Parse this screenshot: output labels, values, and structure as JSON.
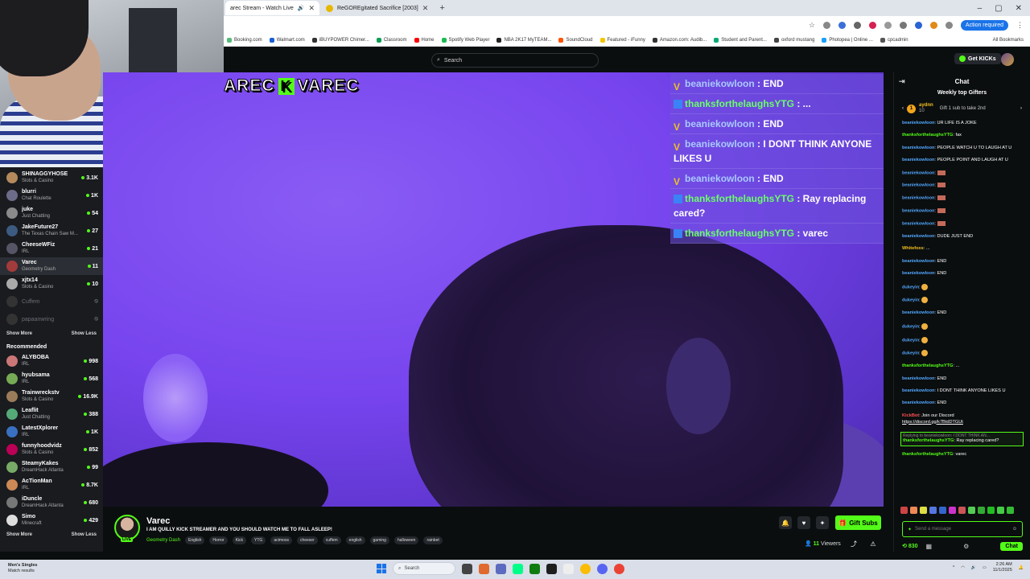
{
  "browser": {
    "tabs": [
      {
        "label": "arec Stream - Watch Live",
        "active": true
      },
      {
        "label": "ReGOREgitated Sacrifice [2003]",
        "active": false
      }
    ],
    "action_required": "Action required",
    "bookmarks": [
      "Booking.com",
      "Walmart.com",
      "iBUYPOWER Chimer...",
      "Classroom",
      "Home",
      "Spotify Web Player",
      "NBA 2K17 MyTEAM...",
      "SoundCloud",
      "Featured - iFunny",
      "Amazon.com: Audib...",
      "Student and Parent...",
      "oxford mustang",
      "Photopea | Online ...",
      "cpcadmin"
    ],
    "all_bookmarks": "All Bookmarks"
  },
  "header": {
    "search_placeholder": "Search",
    "get_kicks": "Get KICKs"
  },
  "sidebar": {
    "following": [
      {
        "name": "SHINAGGYHOSE",
        "category": "Slots & Casino",
        "count": "3.1K",
        "live": true
      },
      {
        "name": "blurri",
        "category": "Chat Roulette",
        "count": "1K",
        "live": true
      },
      {
        "name": "juke",
        "category": "Just Chatting",
        "count": "54",
        "live": true
      },
      {
        "name": "JakeFuture27",
        "category": "The Texas Chain Saw M...",
        "count": "27",
        "live": true
      },
      {
        "name": "CheeseWFiz",
        "category": "IRL",
        "count": "21",
        "live": true
      },
      {
        "name": "Varec",
        "category": "Geometry Dash",
        "count": "11",
        "live": true,
        "selected": true
      },
      {
        "name": "xjtx14",
        "category": "Slots & Casino",
        "count": "10",
        "live": true
      },
      {
        "name": "Cuffem",
        "category": "",
        "count": "",
        "live": false
      },
      {
        "name": "papaanwring",
        "category": "",
        "count": "",
        "live": false
      }
    ],
    "show_more": "Show More",
    "show_less": "Show Less",
    "recommended_title": "Recommended",
    "recommended": [
      {
        "name": "ALYBOBA",
        "category": "IRL",
        "count": "998"
      },
      {
        "name": "hyubsama",
        "category": "IRL",
        "count": "568"
      },
      {
        "name": "Trainwreckstv",
        "category": "Slots & Casino",
        "count": "16.9K"
      },
      {
        "name": "Leaflit",
        "category": "Just Chatting",
        "count": "388"
      },
      {
        "name": "LatestXplorer",
        "category": "IRL",
        "count": "1K"
      },
      {
        "name": "funnyhoodvidz",
        "category": "Slots & Casino",
        "count": "852"
      },
      {
        "name": "SteamyKakes",
        "category": "DreamHack Atlanta",
        "count": "99"
      },
      {
        "name": "AcTionMan",
        "category": "IRL",
        "count": "8.7K"
      },
      {
        "name": "iDuncle",
        "category": "DreamHack Atlanta",
        "count": "680"
      },
      {
        "name": "Simo",
        "category": "Minecraft",
        "count": "429"
      }
    ]
  },
  "overlay": {
    "name_left": "AREC",
    "name_right": "VAREC",
    "chat": [
      {
        "user": "beaniekowloon",
        "text": " : END",
        "style": "u1"
      },
      {
        "user": "thanksforthelaughsYTG",
        "text": " : ...",
        "style": "u2"
      },
      {
        "user": "beaniekowloon",
        "text": " : END",
        "style": "u1"
      },
      {
        "user": "beaniekowloon",
        "text": " : I DONT THINK ANYONE LIKES U",
        "style": "u1"
      },
      {
        "user": "beaniekowloon",
        "text": " : END",
        "style": "u1"
      },
      {
        "user": "thanksforthelaughsYTG",
        "text": " : Ray replacing cared?",
        "style": "u2"
      },
      {
        "user": "thanksforthelaughsYTG",
        "text": " : varec",
        "style": "u2"
      }
    ]
  },
  "stream": {
    "name": "Varec",
    "title": "I AM QUILLY KICK STREAMER AND YOU SHOULD WATCH ME TO FALL ASLEEP!",
    "category": "Geometry Dash",
    "tags": [
      "English",
      "Horror",
      "Kick",
      "YTG",
      "actmoss",
      "cheeser",
      "cuffem",
      "english",
      "gaming",
      "halloween",
      "rainbet"
    ],
    "gift_subs": "Gift Subs",
    "viewers_count": "11",
    "viewers_label": "Viewers",
    "live_badge": "LIVE"
  },
  "chat": {
    "title": "Chat",
    "gifters_title": "Weekly top Gifters",
    "gifter_rank": "1",
    "gifter_name": "aydnn",
    "gifter_count": "10",
    "gifter_prompt": "Gift 1 sub to take 2nd",
    "messages": [
      {
        "user": "beaniekowloon",
        "text": ": UR LIFE IS A JOKE",
        "color": "cb"
      },
      {
        "user": "thanksforthelaughsYTG",
        "text": ": fax",
        "color": "cg"
      },
      {
        "user": "beaniekowloon",
        "text": ": PEOPLE WATCH U TO LAUGH AT U",
        "color": "cb"
      },
      {
        "user": "beaniekowloon",
        "text": ": PEOPLE POINT AND LAUGH AT U",
        "color": "cb"
      },
      {
        "user": "beaniekowloon",
        "text": ":",
        "color": "cb",
        "emote": "r"
      },
      {
        "user": "beaniekowloon",
        "text": ":",
        "color": "cb",
        "emote": "r"
      },
      {
        "user": "beaniekowloon",
        "text": ":",
        "color": "cb",
        "emote": "r"
      },
      {
        "user": "beaniekowloon",
        "text": ":",
        "color": "cb",
        "emote": "r"
      },
      {
        "user": "beaniekowloon",
        "text": ":",
        "color": "cb",
        "emote": "r"
      },
      {
        "user": "beaniekowloon",
        "text": ": DUDE JUST END",
        "color": "cb"
      },
      {
        "user": "Whitefoxs",
        "text": ": ...",
        "color": "cy"
      },
      {
        "user": "beaniekowloon",
        "text": ": END",
        "color": "cb"
      },
      {
        "user": "beaniekowloon",
        "text": ": END",
        "color": "cb"
      },
      {
        "user": "dukeyin",
        "text": ":",
        "color": "cb",
        "emote": "y"
      },
      {
        "user": "dukeyin",
        "text": ":",
        "color": "cb",
        "emote": "y"
      },
      {
        "user": "beaniekowloon",
        "text": ": END",
        "color": "cb"
      },
      {
        "user": "dukeyin",
        "text": ":",
        "color": "cb",
        "emote": "y"
      },
      {
        "user": "dukeyin",
        "text": ":",
        "color": "cb",
        "emote": "y"
      },
      {
        "user": "dukeyin",
        "text": ":",
        "color": "cb",
        "emote": "y"
      },
      {
        "user": "thanksforthelaughsYTG",
        "text": ": ...",
        "color": "cg"
      },
      {
        "user": "beaniekowloon",
        "text": ": END",
        "color": "cb"
      },
      {
        "user": "beaniekowloon",
        "text": ": I DONT THINK ANYONE LIKES U",
        "color": "cb"
      },
      {
        "user": "beaniekowloon",
        "text": ": END",
        "color": "cb"
      },
      {
        "user": "KickBot",
        "text": ": Join our Discord",
        "color": "cr",
        "link": "https://discord.gg/k7BtdDTGUt"
      },
      {
        "user": "thanksforthelaughsYTG",
        "text": ": Ray replacing cared?",
        "color": "cg",
        "reply": "Replying to beaniekowloon: I DONT THINK AN..."
      },
      {
        "user": "thanksforthelaughsYTG",
        "text": ": varec",
        "color": "cg"
      }
    ],
    "input_placeholder": "Send a message",
    "points": "830",
    "chat_button": "Chat"
  },
  "taskbar": {
    "weather_title": "Men's Singles",
    "weather_sub": "Match results",
    "search": "Search",
    "time": "2:26 AM",
    "date": "11/1/2025"
  },
  "colors": {
    "kick_green": "#53fc18",
    "video_purple": "#7744ee",
    "background": "#0b0e0f"
  }
}
